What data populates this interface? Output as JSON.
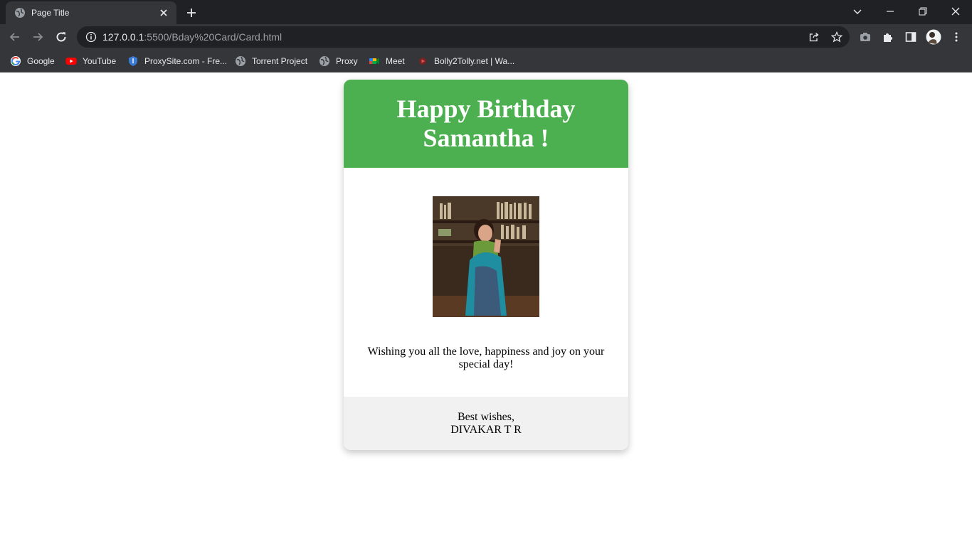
{
  "browser": {
    "tab_title": "Page Title",
    "url_host": "127.0.0.1",
    "url_rest": ":5500/Bday%20Card/Card.html",
    "bookmarks": [
      {
        "label": "Google",
        "icon": "google-icon"
      },
      {
        "label": "YouTube",
        "icon": "youtube-icon"
      },
      {
        "label": "ProxySite.com - Fre...",
        "icon": "shield-icon"
      },
      {
        "label": "Torrent Project",
        "icon": "globe-icon"
      },
      {
        "label": "Proxy",
        "icon": "globe-icon"
      },
      {
        "label": "Meet",
        "icon": "meet-icon"
      },
      {
        "label": "Bolly2Tolly.net | Wa...",
        "icon": "site-icon"
      }
    ]
  },
  "card": {
    "title": "Happy Birthday Samantha !",
    "photo_icon": "birthday-photo",
    "message": "Wishing you all the love, happiness and joy on your special day!",
    "footer_line1": "Best wishes,",
    "footer_line2": "DIVAKAR T R"
  },
  "colors": {
    "header_green": "#4caf50",
    "footer_gray": "#f1f1f1",
    "chrome_dark": "#202124",
    "chrome_mid": "#35363a"
  }
}
